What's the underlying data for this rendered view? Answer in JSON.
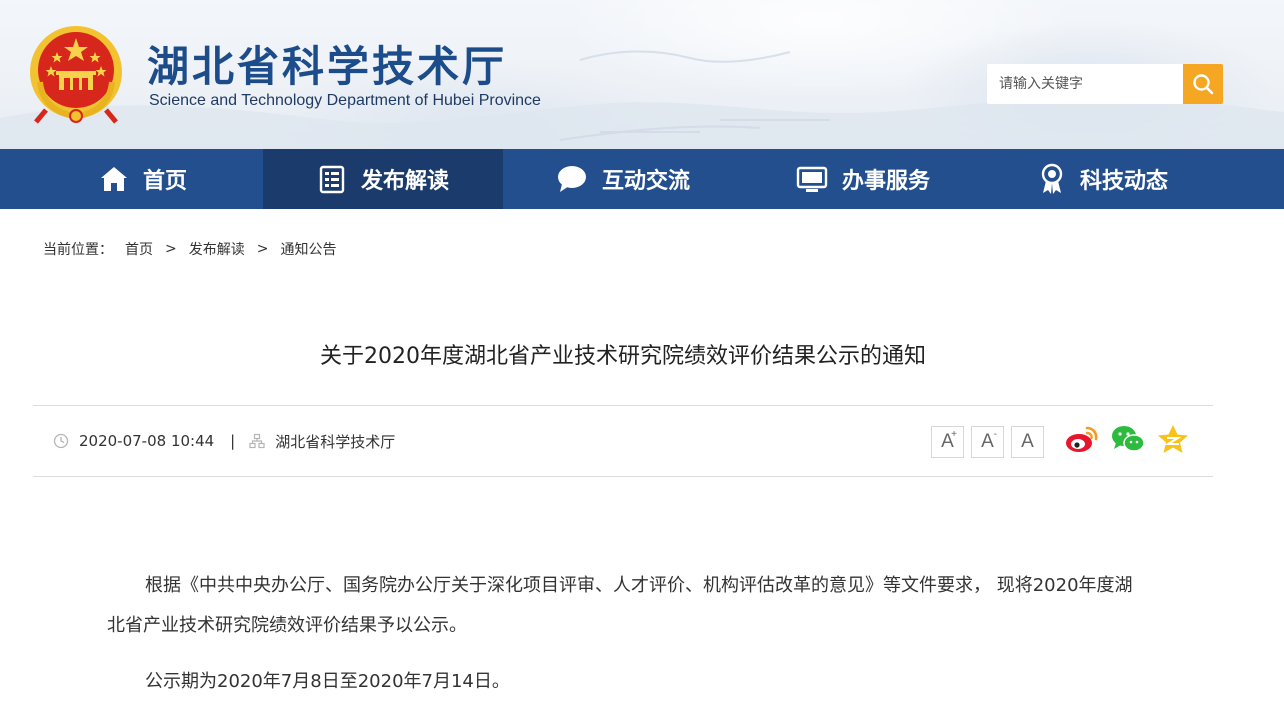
{
  "header": {
    "site_title": "湖北省科学技术厅",
    "site_subtitle": "Science and Technology Department of Hubei Province",
    "search_placeholder": "请输入关键字",
    "emblem_icon": "national-emblem",
    "search_icon": "magnifier"
  },
  "nav": {
    "items": [
      {
        "label": "首页",
        "icon": "home-icon"
      },
      {
        "label": "发布解读",
        "icon": "document-list-icon",
        "active": true
      },
      {
        "label": "互动交流",
        "icon": "chat-bubble-icon"
      },
      {
        "label": "办事服务",
        "icon": "monitor-icon"
      },
      {
        "label": "科技动态",
        "icon": "award-icon"
      }
    ]
  },
  "breadcrumb": {
    "lead": "当前位置：",
    "items": [
      "首页",
      "发布解读",
      "通知公告"
    ],
    "separator": ">"
  },
  "article": {
    "title": "关于2020年度湖北省产业技术研究院绩效评价结果公示的通知",
    "date": "2020-07-08 10:44",
    "divider": "|",
    "source": "湖北省科学技术厅",
    "font_buttons": [
      "A",
      "A",
      "A"
    ],
    "font_plus": "+",
    "font_minus": "-",
    "paragraphs": [
      "根据《中共中央办公厅、国务院办公厅关于深化项目评审、人才评价、机构评估改革的意见》等文件要求， 现将2020年度湖北省产业技术研究院绩效评价结果予以公示。",
      "公示期为2020年7月8日至2020年7月14日。"
    ]
  },
  "colors": {
    "nav_bg": "#234f8f",
    "nav_active": "#1a3b6c",
    "title_blue": "#1d4c8a",
    "search_accent": "#f5a623"
  }
}
